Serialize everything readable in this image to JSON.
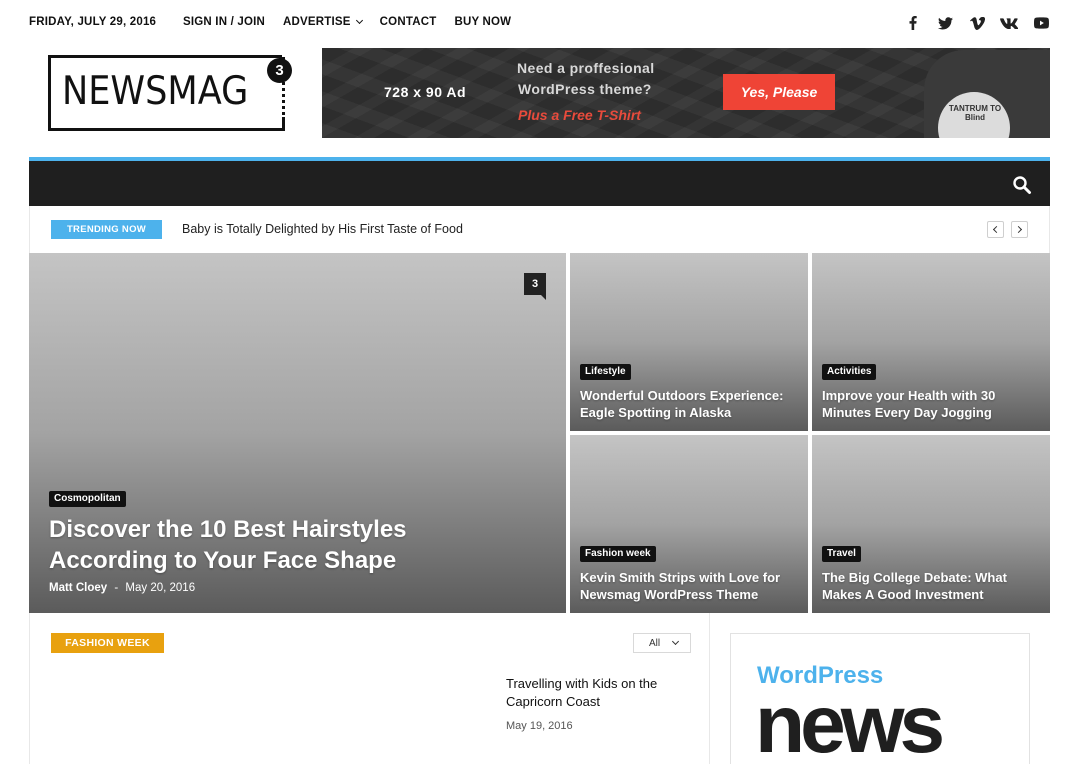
{
  "topbar": {
    "date": "FRIDAY, JULY 29, 2016",
    "menu": [
      "SIGN IN / JOIN",
      "ADVERTISE",
      "CONTACT",
      "BUY NOW"
    ],
    "socials": [
      "facebook-icon",
      "twitter-icon",
      "vimeo-icon",
      "vk-icon",
      "youtube-icon"
    ]
  },
  "logo": {
    "text": "NEWSMAG",
    "badge": "3"
  },
  "ad": {
    "size": "728 x 90 Ad",
    "line1": "Need a proffesional",
    "line2": "WordPress theme?",
    "line3": "Plus a Free T-Shirt",
    "button": "Yes, Please",
    "shirt_text": "TANTRUM TO Blind"
  },
  "nav": {
    "search_icon": "search-icon",
    "accent": "#4db2ec",
    "background": "#1f1f1f"
  },
  "trending": {
    "label": "TRENDING NOW",
    "title": "Baby is Totally Delighted by His First Taste of Food"
  },
  "featured": {
    "big": {
      "category": "Cosmopolitan",
      "title": "Discover the 10 Best Hairstyles According to Your Face Shape",
      "author": "Matt Cloey",
      "separator": "-",
      "date": "May 20, 2016",
      "comments": "3"
    },
    "small": [
      {
        "category": "Lifestyle",
        "title": "Wonderful Outdoors Experience: Eagle Spotting in Alaska"
      },
      {
        "category": "Activities",
        "title": "Improve your Health with 30 Minutes Every Day Jogging"
      },
      {
        "category": "Fashion week",
        "title": "Kevin Smith Strips with Love for Newsmag WordPress Theme"
      },
      {
        "category": "Travel",
        "title": "The Big College Debate: What Makes A Good Investment"
      }
    ]
  },
  "section": {
    "label": "FASHION WEEK",
    "label_color": "#e8a10f",
    "filter": "All",
    "post": {
      "title": "Travelling with Kids on the Capricorn Coast",
      "date": "May 19, 2016"
    }
  },
  "sidebar_ad": {
    "line1": "WordPress",
    "line2": "news"
  }
}
